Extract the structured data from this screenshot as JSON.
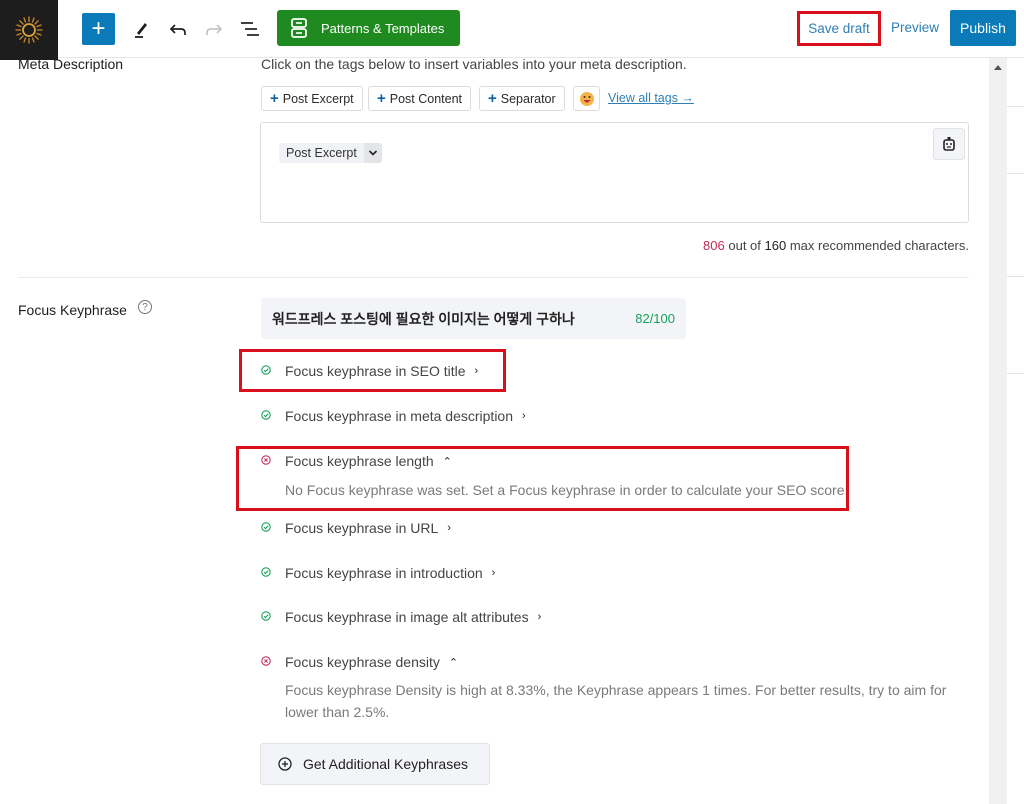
{
  "toolbar": {
    "logo_icon": "sun-logo-icon",
    "add_block_icon": "plus-icon",
    "tools_icon": "pencil-icon",
    "undo_icon": "undo-icon",
    "redo_icon": "redo-icon",
    "list_view_icon": "list-view-icon",
    "patterns_label": "Patterns & Templates",
    "save_draft_label": "Save draft",
    "preview_label": "Preview",
    "publish_label": "Publish"
  },
  "meta_description": {
    "label": "Meta Description",
    "intro": "Click on the tags below to insert variables into your meta description.",
    "tags": [
      {
        "label": "Post Excerpt"
      },
      {
        "label": "Post Content"
      },
      {
        "label": "Separator"
      }
    ],
    "emoji_icon": "emoji-icon",
    "view_all_tags": "View all tags →",
    "editor_chip": "Post Excerpt",
    "ai_icon": "robot-icon",
    "char_count": {
      "current": "806",
      "text_mid": " out of ",
      "max": "160",
      "text_end": " max recommended characters."
    }
  },
  "focus_keyphrase": {
    "label": "Focus Keyphrase",
    "help_icon": "?",
    "keyphrase": "워드프레스 포스팅에 필요한 이미지는 어떻게 구하나",
    "score": "82/100",
    "checks": [
      {
        "label": "Focus keyphrase in SEO title",
        "status": "pass",
        "expanded": false
      },
      {
        "label": "Focus keyphrase in meta description",
        "status": "pass",
        "expanded": false
      },
      {
        "label": "Focus keyphrase length",
        "status": "fail",
        "expanded": true,
        "detail": "No Focus keyphrase was set. Set a Focus keyphrase in order to calculate your SEO score."
      },
      {
        "label": "Focus keyphrase in URL",
        "status": "pass",
        "expanded": false
      },
      {
        "label": "Focus keyphrase in introduction",
        "status": "pass",
        "expanded": false
      },
      {
        "label": "Focus keyphrase in image alt attributes",
        "status": "pass",
        "expanded": false
      },
      {
        "label": "Focus keyphrase density",
        "status": "fail",
        "expanded": true,
        "detail": "Focus keyphrase Density is high at 8.33%, the Keyphrase appears 1 times. For better results, try to aim for lower than 2.5%."
      }
    ],
    "chevron_collapsed": "›",
    "chevron_expanded": "⌃",
    "add_keyphrases_label": "Get Additional Keyphrases"
  },
  "colors": {
    "brand_blue": "#0a7ab8",
    "patterns_green": "#1f8a1f",
    "highlight_red": "#d9101c",
    "pass_green": "#17a05d",
    "fail_red": "#c0305a",
    "link_blue": "#2f7fb4"
  }
}
